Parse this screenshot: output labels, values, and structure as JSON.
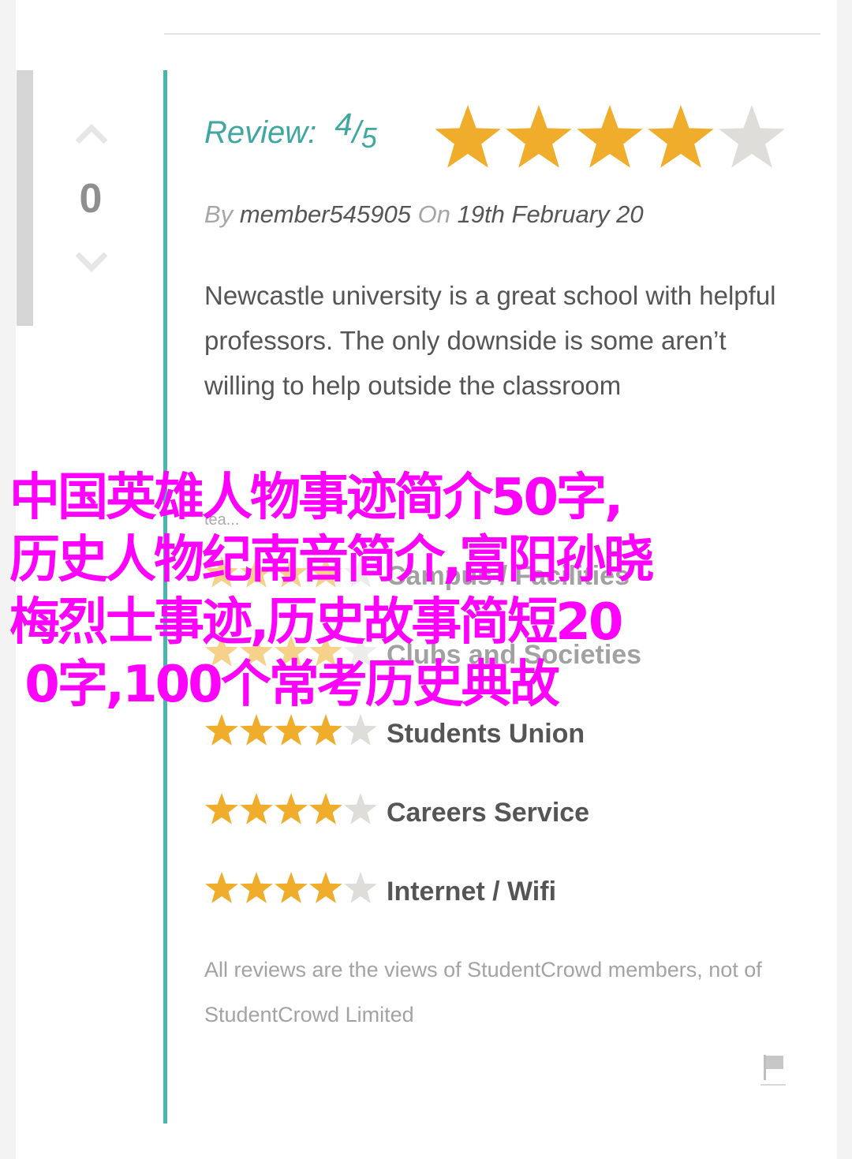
{
  "vote": {
    "count": "0"
  },
  "review": {
    "label": "Review:",
    "score": "4",
    "slash": "/",
    "max": "5",
    "rating": 4,
    "by_label": "By",
    "author": "member545905",
    "on_label": "On",
    "date": "19th February 20",
    "body": "Newcastle university is a great school with helpful professors. The only downside is some aren’t willing to help outside the classroom",
    "truncated": "tea..."
  },
  "categories": [
    {
      "label": "Campus / Facilities",
      "rating": 4
    },
    {
      "label": "Clubs and Societies",
      "rating": 4
    },
    {
      "label": "Students Union",
      "rating": 4
    },
    {
      "label": "Careers Service",
      "rating": 4
    },
    {
      "label": "Internet / Wifi",
      "rating": 4
    }
  ],
  "disclaimer": "All reviews are the views of StudentCrowd members, not of StudentCrowd Limited",
  "overlay": {
    "lines": [
      "中国英雄人物事迹简介50字,",
      "历史人物纪南音简介,富阳孙晓",
      "梅烈士事迹,历史故事简短20",
      " 0字,100个常考历史典故"
    ]
  },
  "colors": {
    "accent": "#49b5ad",
    "star_filled": "#f0ad2b",
    "star_empty": "#deddd9",
    "overlay_text": "#ff00ff"
  },
  "icons": {
    "upvote": "chevron-up-icon",
    "downvote": "chevron-down-icon",
    "star": "star-icon",
    "flag": "flag-icon"
  }
}
